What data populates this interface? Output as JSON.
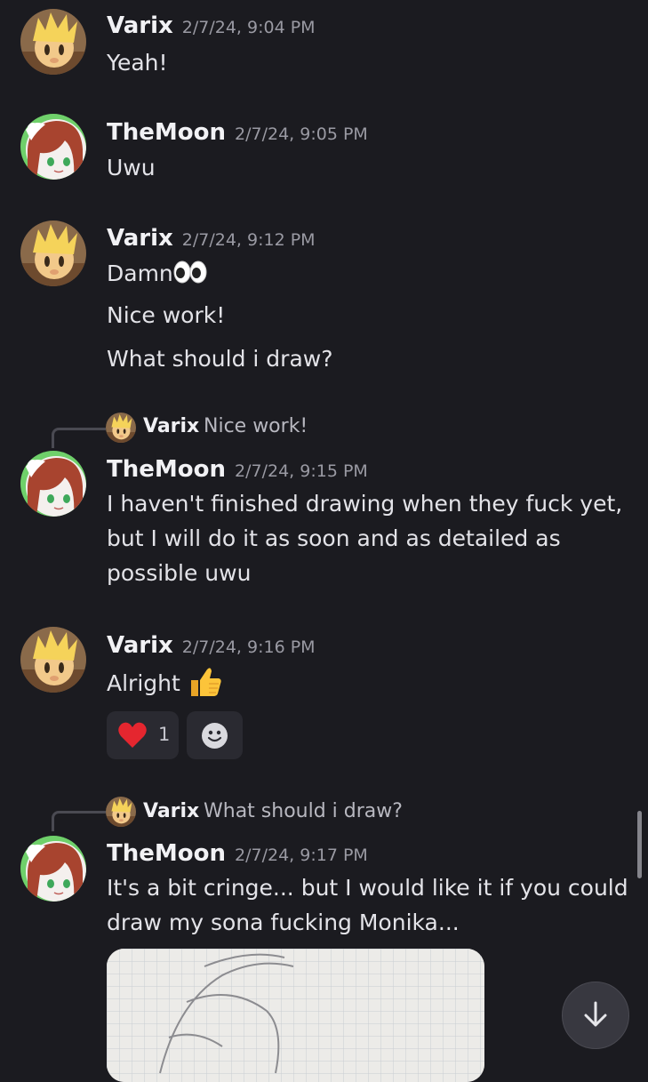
{
  "messages": [
    {
      "author": "Varix",
      "time": "2/7/24, 9:04 PM",
      "lines": [
        "Yeah!"
      ]
    },
    {
      "author": "TheMoon",
      "time": "2/7/24, 9:05 PM",
      "lines": [
        "Uwu"
      ]
    },
    {
      "author": "Varix",
      "time": "2/7/24, 9:12 PM",
      "lines": [
        "Damn",
        "Nice work!",
        "What should i draw?"
      ],
      "emoji": "eyes-emoji"
    },
    {
      "reply_to": {
        "author": "Varix",
        "text": "Nice work!"
      },
      "author": "TheMoon",
      "time": "2/7/24, 9:15 PM",
      "lines": [
        "I haven't finished drawing when they fuck yet,",
        "but I will do it as soon and as detailed as",
        "possible uwu"
      ]
    },
    {
      "author": "Varix",
      "time": "2/7/24, 9:16 PM",
      "lines": [
        "Alright"
      ],
      "emoji": "thumbs-up-emoji",
      "reactions": [
        {
          "emoji": "red-heart-emoji",
          "count": "1"
        }
      ],
      "add_reaction_icon": "smiley-icon"
    },
    {
      "reply_to": {
        "author": "Varix",
        "text": "What should i draw?"
      },
      "author": "TheMoon",
      "time": "2/7/24, 9:17 PM",
      "lines": [
        "It's a bit cringe... but I would like it if you could",
        "draw my sona fucking Monika..."
      ],
      "attachment": "image-attachment"
    }
  ],
  "jump_button_icon": "arrow-down-icon",
  "colors": {
    "background": "#1b1b20",
    "timestamp": "#9a9aa3",
    "reaction_bg": "#2a2a31"
  }
}
